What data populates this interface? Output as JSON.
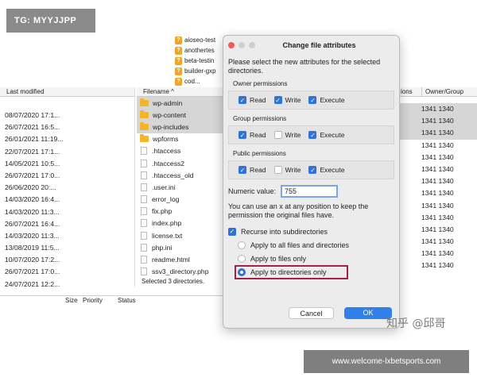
{
  "watermarks": {
    "top": "TG: MYYJJPP",
    "bottom": "www.welcome-lxbetsports.com",
    "author": "知乎 @邱哥"
  },
  "remote_top_files": [
    "aioseo-test",
    "anothertes",
    "beta-testin",
    "builder-gxp",
    "cod..."
  ],
  "left_pane": {
    "column_header": "Last modified",
    "rows": [
      "08/07/2020 17:1...",
      "26/07/2021 16:5...",
      "26/01/2021 11:19...",
      "22/07/2021 17:1...",
      "14/05/2021 10:5...",
      "26/07/2021 17:0...",
      "26/06/2020 20:...",
      "14/03/2020 16:4...",
      "14/03/2020 11:3...",
      "26/07/2021 16:4...",
      "14/03/2020 11:3...",
      "13/08/2019 11:5...",
      "10/07/2020 17:2...",
      "26/07/2021 17:0...",
      "24/07/2021 12:2..."
    ]
  },
  "mid_pane": {
    "column_header": "Filename",
    "rows": [
      {
        "name": "wp-admin",
        "type": "folder",
        "selected": true
      },
      {
        "name": "wp-content",
        "type": "folder",
        "selected": true
      },
      {
        "name": "wp-includes",
        "type": "folder",
        "selected": true
      },
      {
        "name": "wpforms",
        "type": "folder",
        "selected": false
      },
      {
        "name": ".htaccess",
        "type": "file",
        "selected": false
      },
      {
        "name": ".htaccess2",
        "type": "file",
        "selected": false
      },
      {
        "name": ".htaccess_old",
        "type": "file",
        "selected": false
      },
      {
        "name": ".user.ini",
        "type": "file",
        "selected": false
      },
      {
        "name": "error_log",
        "type": "file",
        "selected": false
      },
      {
        "name": "fix.php",
        "type": "file",
        "selected": false
      },
      {
        "name": "index.php",
        "type": "file",
        "selected": false
      },
      {
        "name": "license.txt",
        "type": "file",
        "selected": false
      },
      {
        "name": "php.ini",
        "type": "file",
        "selected": false
      },
      {
        "name": "readme.html",
        "type": "file",
        "selected": false
      },
      {
        "name": "ssv3_directory.php",
        "type": "file",
        "selected": false
      }
    ],
    "status": "Selected 3 directories."
  },
  "right_pane": {
    "col_permissions_tail": "ions",
    "col_owner": "Owner/Group",
    "rows": [
      "1341 1340",
      "1341 1340",
      "1341 1340",
      "1341 1340",
      "1341 1340",
      "1341 1340",
      "1341 1340",
      "1341 1340",
      "1341 1340",
      "1341 1340",
      "1341 1340",
      "1341 1340",
      "1341 1340",
      "1341 1340"
    ],
    "selected_count": 3
  },
  "queue": {
    "size": "Size",
    "priority": "Priority",
    "status": "Status"
  },
  "dialog": {
    "title": "Change file attributes",
    "intro": "Please select the new attributes for the selected directories.",
    "groups": [
      {
        "label": "Owner permissions",
        "read": true,
        "write": true,
        "execute": true
      },
      {
        "label": "Group permissions",
        "read": true,
        "write": false,
        "execute": true
      },
      {
        "label": "Public permissions",
        "read": true,
        "write": false,
        "execute": true
      }
    ],
    "perm_labels": {
      "read": "Read",
      "write": "Write",
      "execute": "Execute"
    },
    "numeric_label": "Numeric value:",
    "numeric_value": "755",
    "hint": "You can use an x at any position to keep the permission the original files have.",
    "recurse_label": "Recurse into subdirectories",
    "recurse_checked": true,
    "options": [
      {
        "label": "Apply to all files and directories",
        "selected": false
      },
      {
        "label": "Apply to files only",
        "selected": false
      },
      {
        "label": "Apply to directories only",
        "selected": true
      }
    ],
    "cancel_label": "Cancel",
    "ok_label": "OK"
  }
}
